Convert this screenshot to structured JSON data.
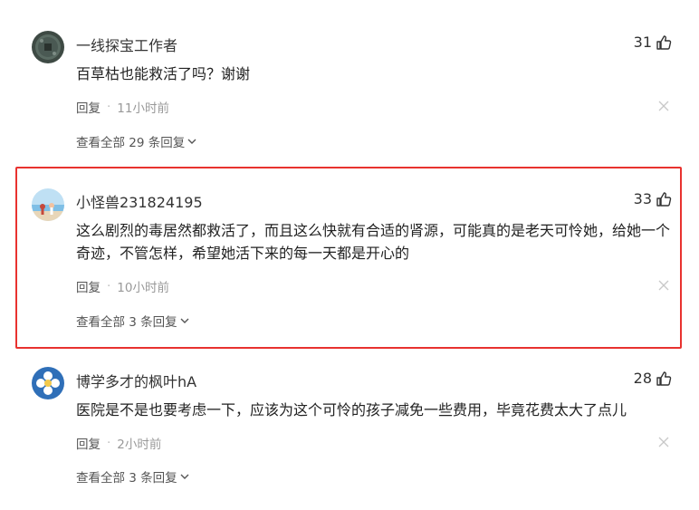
{
  "comments": [
    {
      "username": "一线探宝工作者",
      "likes": "31",
      "text": "百草枯也能救活了吗？谢谢",
      "reply_label": "回复",
      "time": "11小时前",
      "view_replies": "查看全部 29 条回复",
      "avatar_icon": "coin-avatar-icon"
    },
    {
      "username": "小怪兽231824195",
      "likes": "33",
      "text": "这么剧烈的毒居然都救活了，而且这么快就有合适的肾源，可能真的是老天可怜她，给她一个奇迹，不管怎样，希望她活下来的每一天都是开心的",
      "reply_label": "回复",
      "time": "10小时前",
      "view_replies": "查看全部 3 条回复",
      "avatar_icon": "beach-avatar-icon",
      "highlighted": true,
      "highlight_color": "#e8322f"
    },
    {
      "username": "博学多才的枫叶hA",
      "likes": "28",
      "text": "医院是不是也要考虑一下，应该为这个可怜的孩子减免一些费用，毕竟花费太大了点儿",
      "reply_label": "回复",
      "time": "2小时前",
      "view_replies": "查看全部 3 条回复",
      "avatar_icon": "flower-avatar-icon"
    }
  ]
}
